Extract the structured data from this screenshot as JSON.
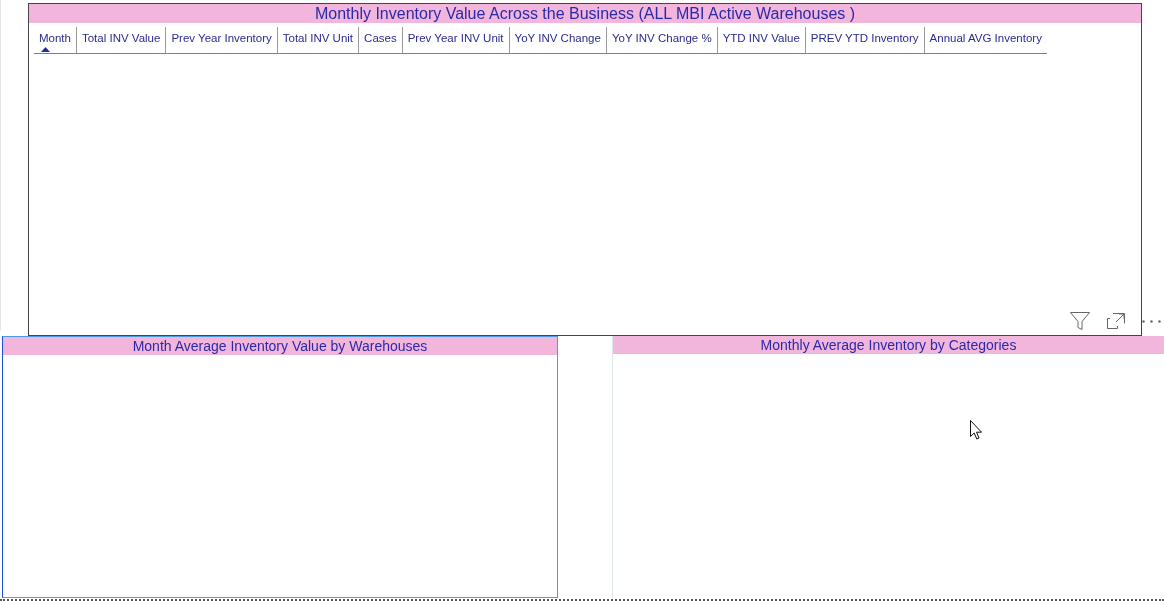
{
  "top_visual": {
    "title": "Monthly Inventory Value Across the Business (ALL MBI Active Warehouses )",
    "columns": [
      {
        "label": "Month",
        "sorted": true
      },
      {
        "label": "Total INV Value",
        "sorted": false
      },
      {
        "label": "Prev Year Inventory",
        "sorted": false
      },
      {
        "label": "Total INV Unit",
        "sorted": false
      },
      {
        "label": "Cases",
        "sorted": false
      },
      {
        "label": "Prev Year INV Unit",
        "sorted": false
      },
      {
        "label": "YoY INV Change",
        "sorted": false
      },
      {
        "label": "YoY INV Change %",
        "sorted": false
      },
      {
        "label": "YTD INV Value",
        "sorted": false
      },
      {
        "label": "PREV YTD Inventory",
        "sorted": false
      },
      {
        "label": "Annual AVG Inventory",
        "sorted": false
      }
    ]
  },
  "visuals": [
    {
      "title": "Month Average Inventory Value by Warehouses",
      "selected": true,
      "hovered": false
    },
    {
      "title": "Monthly Average Inventory by Categories",
      "selected": false,
      "hovered": true
    }
  ]
}
